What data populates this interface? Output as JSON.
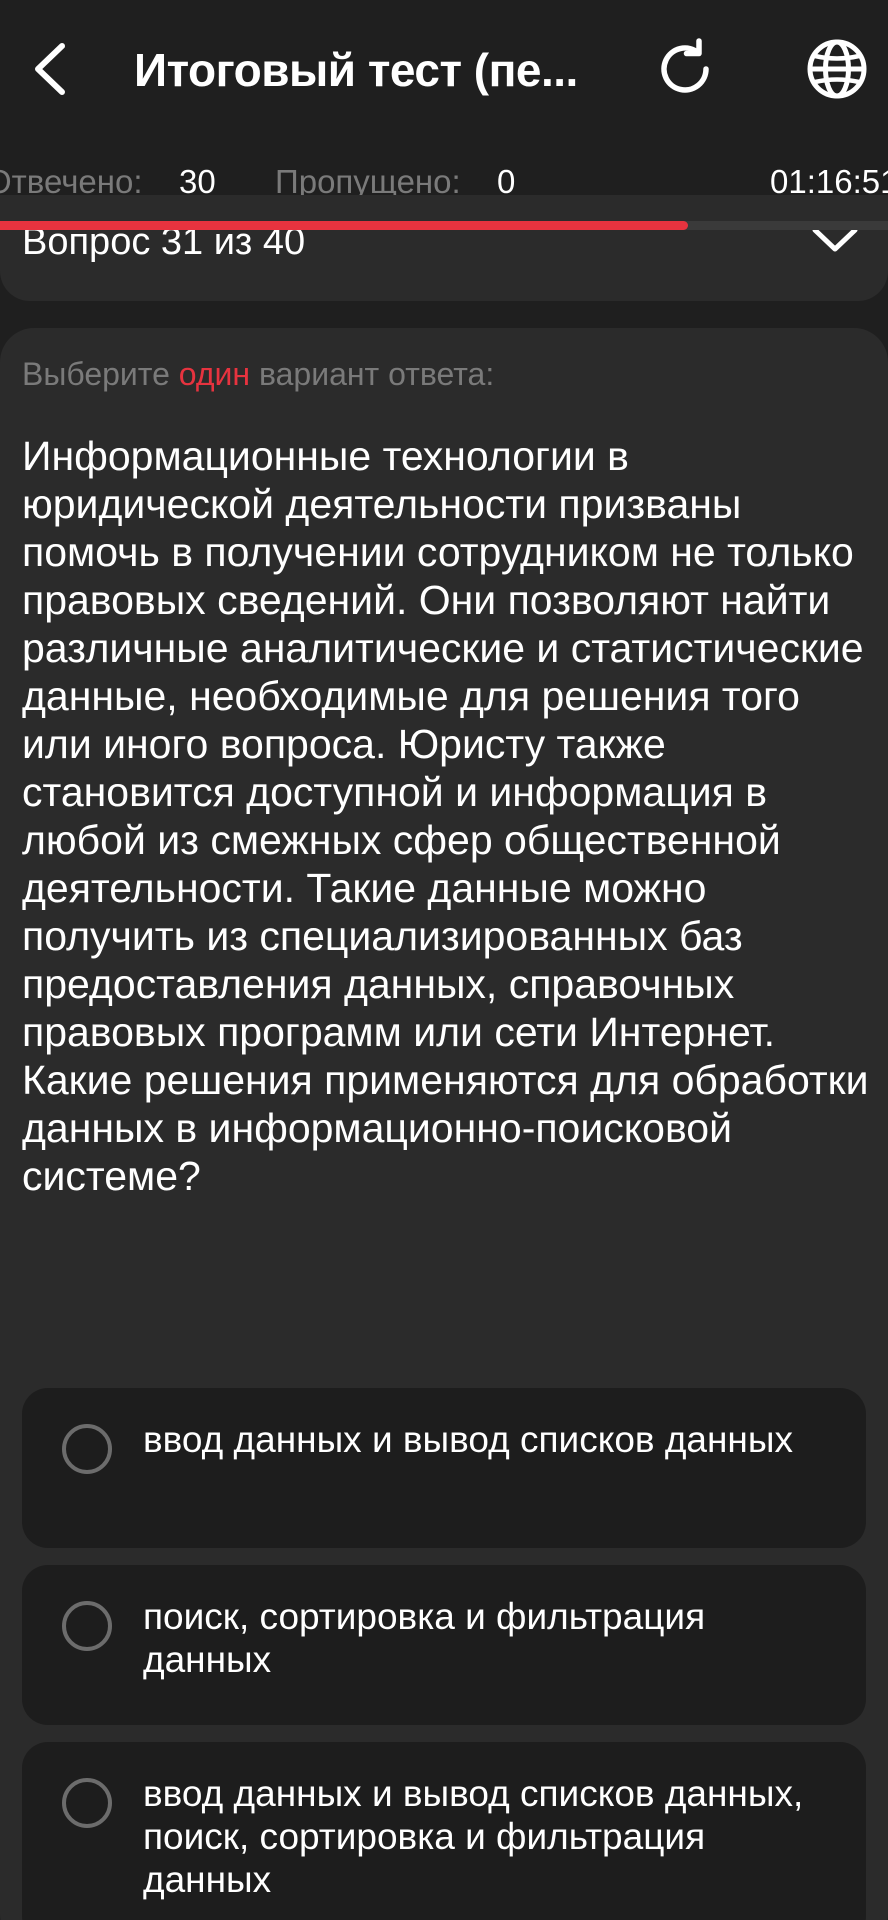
{
  "header": {
    "title": "Итоговый тест (пе...",
    "back_icon": "chevron-left-icon",
    "refresh_icon": "refresh-icon",
    "globe_icon": "globe-icon"
  },
  "status": {
    "answered_label": "Отвечено:",
    "answered_value": "30",
    "skipped_label": "Пропущено:",
    "skipped_value": "0",
    "timer": "01:16:51"
  },
  "progress": {
    "fraction": 0.775,
    "color": "#e7333f"
  },
  "question_selector": {
    "label": "Вопрос 31 из 40"
  },
  "card": {
    "instruction_prefix": "Выберите",
    "instruction_accent": "один",
    "instruction_suffix": "вариант ответа:",
    "question_text": "Информационные технологии в юридической деятельности призваны помочь в получении сотрудником не только правовых сведений. Они позволяют найти различные аналитические и статистические данные, необходимые для решения того или иного вопроса. Юристу также становится доступной и информация в любой из смежных сфер общественной деятельности. Такие данные можно получить из специализированных баз предоставления данных, справочных правовых программ или сети Интернет. Какие решения применяются для обработки данных в информационно-поисковой системе?",
    "options": [
      {
        "text": "ввод данных и вывод списков данных"
      },
      {
        "text": "поиск, сортировка и фильтрация данных"
      },
      {
        "text": "ввод данных и вывод списков данных, поиск, сортировка и фильтрация данных"
      }
    ]
  },
  "colors": {
    "background": "#1f1f1f",
    "card": "#2b2b2b",
    "option": "#1d1d1d",
    "accent": "#e7333f",
    "muted": "#7a7a7a"
  }
}
